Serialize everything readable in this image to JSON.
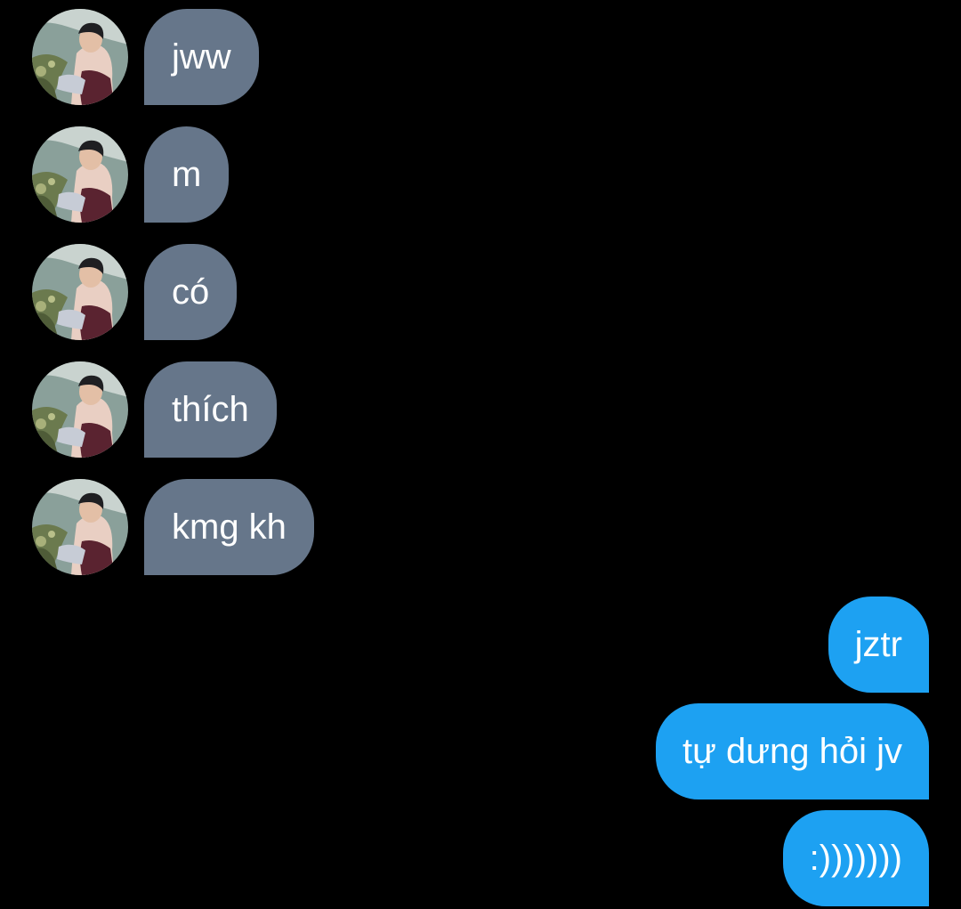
{
  "conversation": {
    "incoming": [
      {
        "text": "jww"
      },
      {
        "text": "m"
      },
      {
        "text": "có"
      },
      {
        "text": "thích"
      },
      {
        "text": "kmg kh"
      }
    ],
    "outgoing": [
      {
        "text": "jztr"
      },
      {
        "text": "tự dưng hỏi jv"
      },
      {
        "text": ":)))))))"
      }
    ]
  },
  "colors": {
    "background": "#000000",
    "incoming_bubble": "#66768a",
    "outgoing_bubble": "#1da1f2",
    "bubble_text": "#ffffff"
  },
  "icons": {
    "avatar": "avatar-photo"
  }
}
